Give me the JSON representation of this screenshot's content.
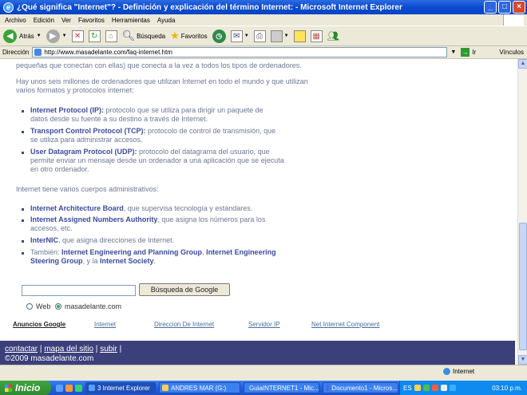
{
  "window": {
    "title": "¿Qué significa \"Internet\"? - Definición y explicación del término Internet: - Microsoft Internet Explorer",
    "minimize": "_",
    "maximize": "□",
    "close": "×"
  },
  "menu": [
    "Archivo",
    "Edición",
    "Ver",
    "Favoritos",
    "Herramientas",
    "Ayuda"
  ],
  "toolbar": {
    "back_label": "Atrás",
    "search_label": "Búsqueda",
    "favorites_label": "Favoritos"
  },
  "address": {
    "label": "Dirección",
    "url": "http://www.masadelante.com/faq-internet.htm",
    "go_label": "Ir",
    "links_label": "Vínculos"
  },
  "content": {
    "intro_tail": "pequeñas que conectan con ellas) que conecta a la vez a todos los tipos de ordenadores.",
    "para2_line1": "Hay unos seis millones de ordenadores que utilizan Internet en todo el mundo y que utilizan",
    "para2_line2": "varios formatos y protocolos internet:",
    "protocols": [
      {
        "term": "Internet Protocol (IP):",
        "line1": " protocolo que se utiliza para dirigir un paquete de",
        "line2": "datos desde su fuente a su destino a través de Internet."
      },
      {
        "term": "Transport Control Protocol (TCP):",
        "line1": " protocolo de control de transmisión, que",
        "line2": "se utiliza para administrar accesos."
      },
      {
        "term": "User Datagram Protocol (UDP):",
        "line1": " protocolo del datagrama del usuario, que",
        "line2": "permite enviar un mensaje desde un ordenador a una aplicación que se ejecuta",
        "line3": "en otro ordenador."
      }
    ],
    "admin_intro": "Internet tiene varios cuerpos administrativos:",
    "admin": [
      {
        "term": "Internet Architecture Board",
        "line1": ", que supervisa tecnología y estándares."
      },
      {
        "term": "Internet Assigned Numbers Authority",
        "line1": ", que asigna los números para los",
        "line2": "accesos, etc."
      },
      {
        "term": "InterNIC",
        "line1": ", que asigna direcciones de Internet."
      },
      {
        "prefix": "También: ",
        "term": "Internet Engineering and Planning Group",
        "mid": ", ",
        "term2": "Internet Engineering",
        "term3": "Steering Group",
        "mid2": ", y la ",
        "term4": "Internet Society",
        "end": "."
      }
    ]
  },
  "search": {
    "input_value": "",
    "button_label": "Búsqueda de Google",
    "radio_web": "Web",
    "radio_site": "masadelante.com"
  },
  "ads": [
    "Anuncios Google",
    "Internet",
    "Direccion De Internet",
    "Servidor IP",
    "Net Internet Component"
  ],
  "footer": {
    "links": [
      "contactar",
      "mapa del sitio",
      "subir"
    ],
    "separator": "|",
    "copyright": "©2009 masadelante.com"
  },
  "status": {
    "zone": "Internet"
  },
  "taskbar": {
    "start_label": "Inicio",
    "tasks": [
      "3 Internet Explorer",
      "ANDRES MAR (G:)",
      "GuiaINTERNET1 - Mic...",
      "Documento1 - Micros..."
    ],
    "lang": "ES",
    "clock": "03:10 p.m."
  }
}
